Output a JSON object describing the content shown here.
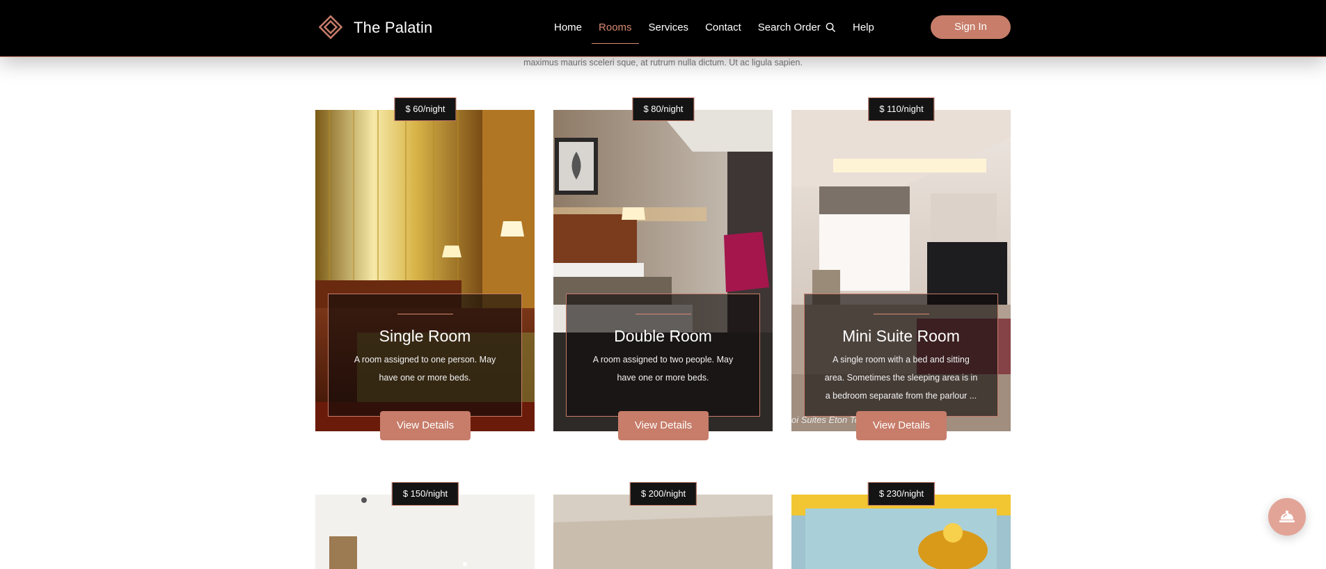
{
  "brand": {
    "name": "The Palatin",
    "logo_icon": "diamond-logo-icon",
    "accent": "#c77d6a"
  },
  "nav": {
    "items": [
      {
        "label": "Home",
        "active": false
      },
      {
        "label": "Rooms",
        "active": true
      },
      {
        "label": "Services",
        "active": false
      },
      {
        "label": "Contact",
        "active": false
      },
      {
        "label": "Search Order",
        "active": false,
        "icon": "search-icon"
      },
      {
        "label": "Help",
        "active": false
      }
    ],
    "signin_label": "Sign In"
  },
  "intro_text": "maximus mauris sceleri sque, at rutrum nulla dictum. Ut ac ligula sapien.",
  "rooms": [
    {
      "price": "$ 60/night",
      "title": "Single Room",
      "desc": "A room assigned to one person. May have one or more beds.",
      "button": "View Details"
    },
    {
      "price": "$ 80/night",
      "title": "Double Room",
      "desc": "A room assigned to two people. May have one or more beds.",
      "button": "View Details"
    },
    {
      "price": "$ 110/night",
      "title": "Mini Suite Room",
      "desc": "A single room with a bed and sitting area. Sometimes the sleeping area is in a bedroom separate from the parlour ...",
      "button": "View Details",
      "image_caption": "oi Suites Eton To"
    },
    {
      "price": "$ 150/night"
    },
    {
      "price": "$ 200/night"
    },
    {
      "price": "$ 230/night"
    }
  ],
  "floating_button_icon": "service-bell-icon"
}
